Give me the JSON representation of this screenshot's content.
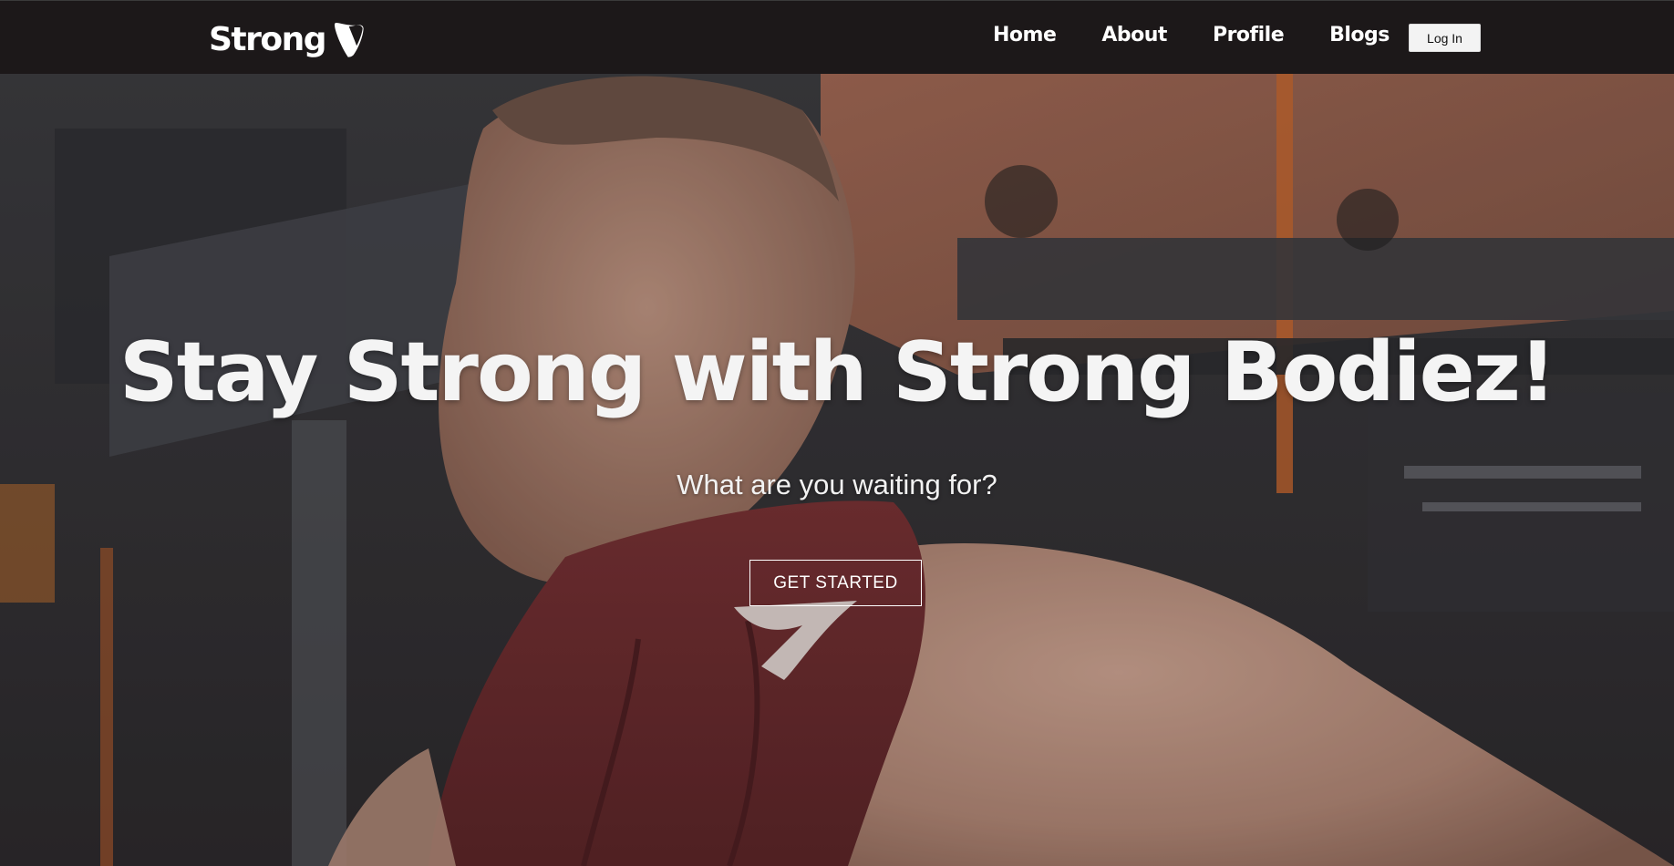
{
  "navbar": {
    "brand": {
      "text": "Strong",
      "logo_icon": "typo3-logo-icon"
    },
    "links": [
      {
        "label": "Home"
      },
      {
        "label": "About"
      },
      {
        "label": "Profile"
      },
      {
        "label": "Blogs"
      }
    ],
    "login_label": "Log In"
  },
  "hero": {
    "title": "Stay Strong with Strong Bodiez!",
    "subtitle": "What are you waiting for?",
    "cta_label": "GET STARTED",
    "background_image": "man-at-gym-in-maroon-sleeveless-hoodie"
  },
  "colors": {
    "navbar_bg": "#1c1819",
    "hero_text": "#f4f4f4",
    "login_bg": "#f3f3f3",
    "hoodie": "#6e2a2c",
    "gym_accent": "#d8662a"
  }
}
